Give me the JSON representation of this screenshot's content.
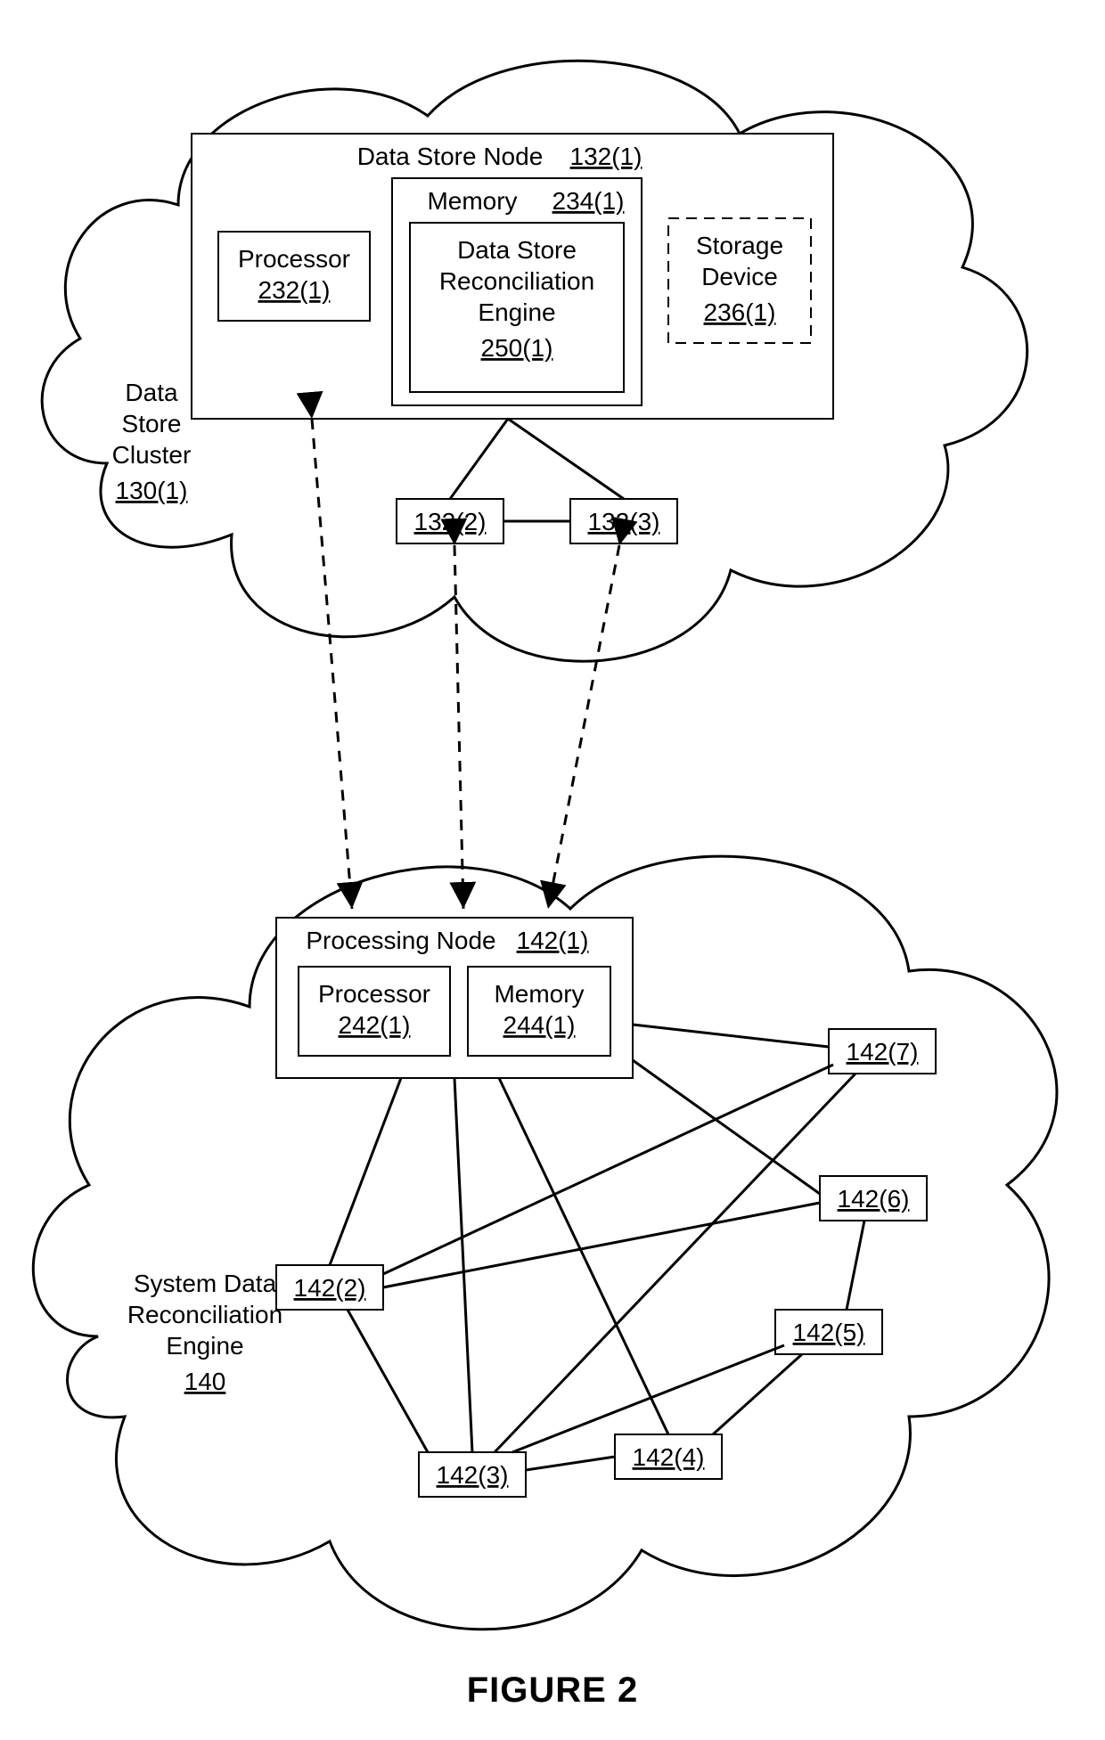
{
  "figure_title": "FIGURE 2",
  "top_cloud": {
    "label": {
      "line1": "Data",
      "line2": "Store",
      "line3": "Cluster",
      "ref": "130(1)"
    },
    "data_store_node": {
      "label": "Data Store Node",
      "ref": "132(1)",
      "processor": {
        "label": "Processor",
        "ref": "232(1)"
      },
      "memory": {
        "label": "Memory",
        "ref": "234(1)",
        "engine": {
          "line1": "Data Store",
          "line2": "Reconciliation",
          "line3": "Engine",
          "ref": "250(1)"
        }
      },
      "storage": {
        "line1": "Storage",
        "line2": "Device",
        "ref": "236(1)"
      }
    },
    "nodes": {
      "n2": "132(2)",
      "n3": "132(3)"
    }
  },
  "bottom_cloud": {
    "label": {
      "line1": "System Data",
      "line2": "Reconciliation",
      "line3": "Engine",
      "ref": "140"
    },
    "processing_node": {
      "label": "Processing Node",
      "ref": "142(1)",
      "processor": {
        "label": "Processor",
        "ref": "242(1)"
      },
      "memory": {
        "label": "Memory",
        "ref": "244(1)"
      }
    },
    "nodes": {
      "n2": "142(2)",
      "n3": "142(3)",
      "n4": "142(4)",
      "n5": "142(5)",
      "n6": "142(6)",
      "n7": "142(7)"
    }
  }
}
